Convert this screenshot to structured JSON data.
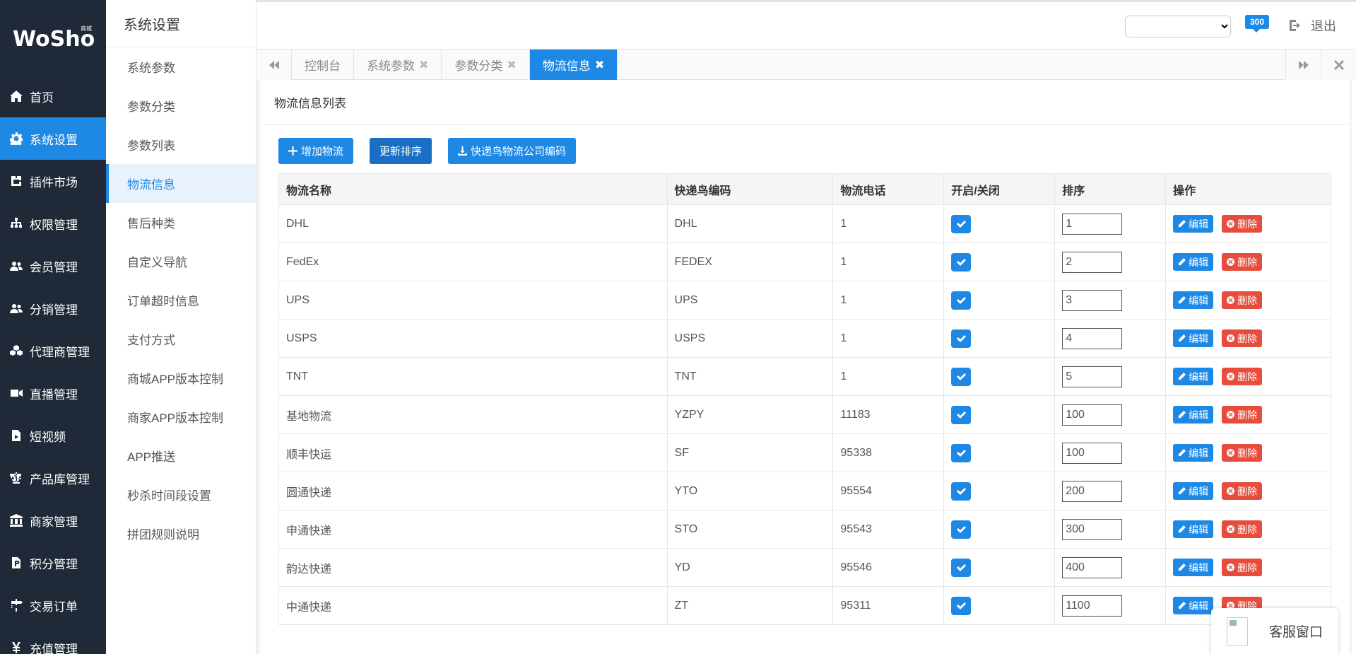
{
  "logo": {
    "text": "WoShop",
    "badge": "商城"
  },
  "nav": {
    "items": [
      {
        "label": "首页",
        "icon": "home-icon"
      },
      {
        "label": "系统设置",
        "icon": "gear-icon",
        "active": true
      },
      {
        "label": "插件市场",
        "icon": "plugin-icon"
      },
      {
        "label": "权限管理",
        "icon": "sitemap-icon"
      },
      {
        "label": "会员管理",
        "icon": "users-icon"
      },
      {
        "label": "分销管理",
        "icon": "users-icon"
      },
      {
        "label": "代理商管理",
        "icon": "cubes-icon"
      },
      {
        "label": "直播管理",
        "icon": "video-icon"
      },
      {
        "label": "短视频",
        "icon": "file-video-icon"
      },
      {
        "label": "产品库管理",
        "icon": "balance-icon"
      },
      {
        "label": "商家管理",
        "icon": "bank-icon"
      },
      {
        "label": "积分管理",
        "icon": "file-points-icon"
      },
      {
        "label": "交易订单",
        "icon": "signpost-icon"
      },
      {
        "label": "充值管理",
        "icon": "yen-icon"
      }
    ]
  },
  "sub": {
    "title": "系统设置",
    "items": [
      {
        "label": "系统参数"
      },
      {
        "label": "参数分类"
      },
      {
        "label": "参数列表"
      },
      {
        "label": "物流信息",
        "active": true
      },
      {
        "label": "售后种类"
      },
      {
        "label": "自定义导航"
      },
      {
        "label": "订单超时信息"
      },
      {
        "label": "支付方式"
      },
      {
        "label": "商城APP版本控制"
      },
      {
        "label": "商家APP版本控制"
      },
      {
        "label": "APP推送"
      },
      {
        "label": "秒杀时间段设置"
      },
      {
        "label": "拼团规则说明"
      }
    ]
  },
  "header": {
    "message_count": "300",
    "logout_label": "退出"
  },
  "tabs": [
    {
      "label": "控制台",
      "closable": false
    },
    {
      "label": "系统参数",
      "closable": true
    },
    {
      "label": "参数分类",
      "closable": true
    },
    {
      "label": "物流信息",
      "closable": true,
      "active": true
    }
  ],
  "panel": {
    "title": "物流信息列表",
    "buttons": {
      "add": "增加物流",
      "sort": "更新排序",
      "export": "快递鸟物流公司编码"
    }
  },
  "table": {
    "headers": [
      "物流名称",
      "快递鸟编码",
      "物流电话",
      "开启/关闭",
      "排序",
      "操作"
    ],
    "edit_label": "编辑",
    "delete_label": "删除",
    "rows": [
      {
        "name": "DHL",
        "code": "DHL",
        "phone": "1",
        "enabled": true,
        "sort": "1"
      },
      {
        "name": "FedEx",
        "code": "FEDEX",
        "phone": "1",
        "enabled": true,
        "sort": "2"
      },
      {
        "name": "UPS",
        "code": "UPS",
        "phone": "1",
        "enabled": true,
        "sort": "3"
      },
      {
        "name": "USPS",
        "code": "USPS",
        "phone": "1",
        "enabled": true,
        "sort": "4"
      },
      {
        "name": "TNT",
        "code": "TNT",
        "phone": "1",
        "enabled": true,
        "sort": "5"
      },
      {
        "name": "基地物流",
        "code": "YZPY",
        "phone": "11183",
        "enabled": true,
        "sort": "100"
      },
      {
        "name": "顺丰快运",
        "code": "SF",
        "phone": "95338",
        "enabled": true,
        "sort": "100"
      },
      {
        "name": "圆通快递",
        "code": "YTO",
        "phone": "95554",
        "enabled": true,
        "sort": "200"
      },
      {
        "name": "申通快递",
        "code": "STO",
        "phone": "95543",
        "enabled": true,
        "sort": "300"
      },
      {
        "name": "韵达快递",
        "code": "YD",
        "phone": "95546",
        "enabled": true,
        "sort": "400"
      },
      {
        "name": "中通快递",
        "code": "ZT",
        "phone": "95311",
        "enabled": true,
        "sort": "1100"
      }
    ]
  },
  "customer_service": {
    "label": "客服窗口"
  },
  "colors": {
    "sidebar_bg": "#1f2937",
    "accent": "#1e88e5",
    "danger": "#e74c3c"
  }
}
